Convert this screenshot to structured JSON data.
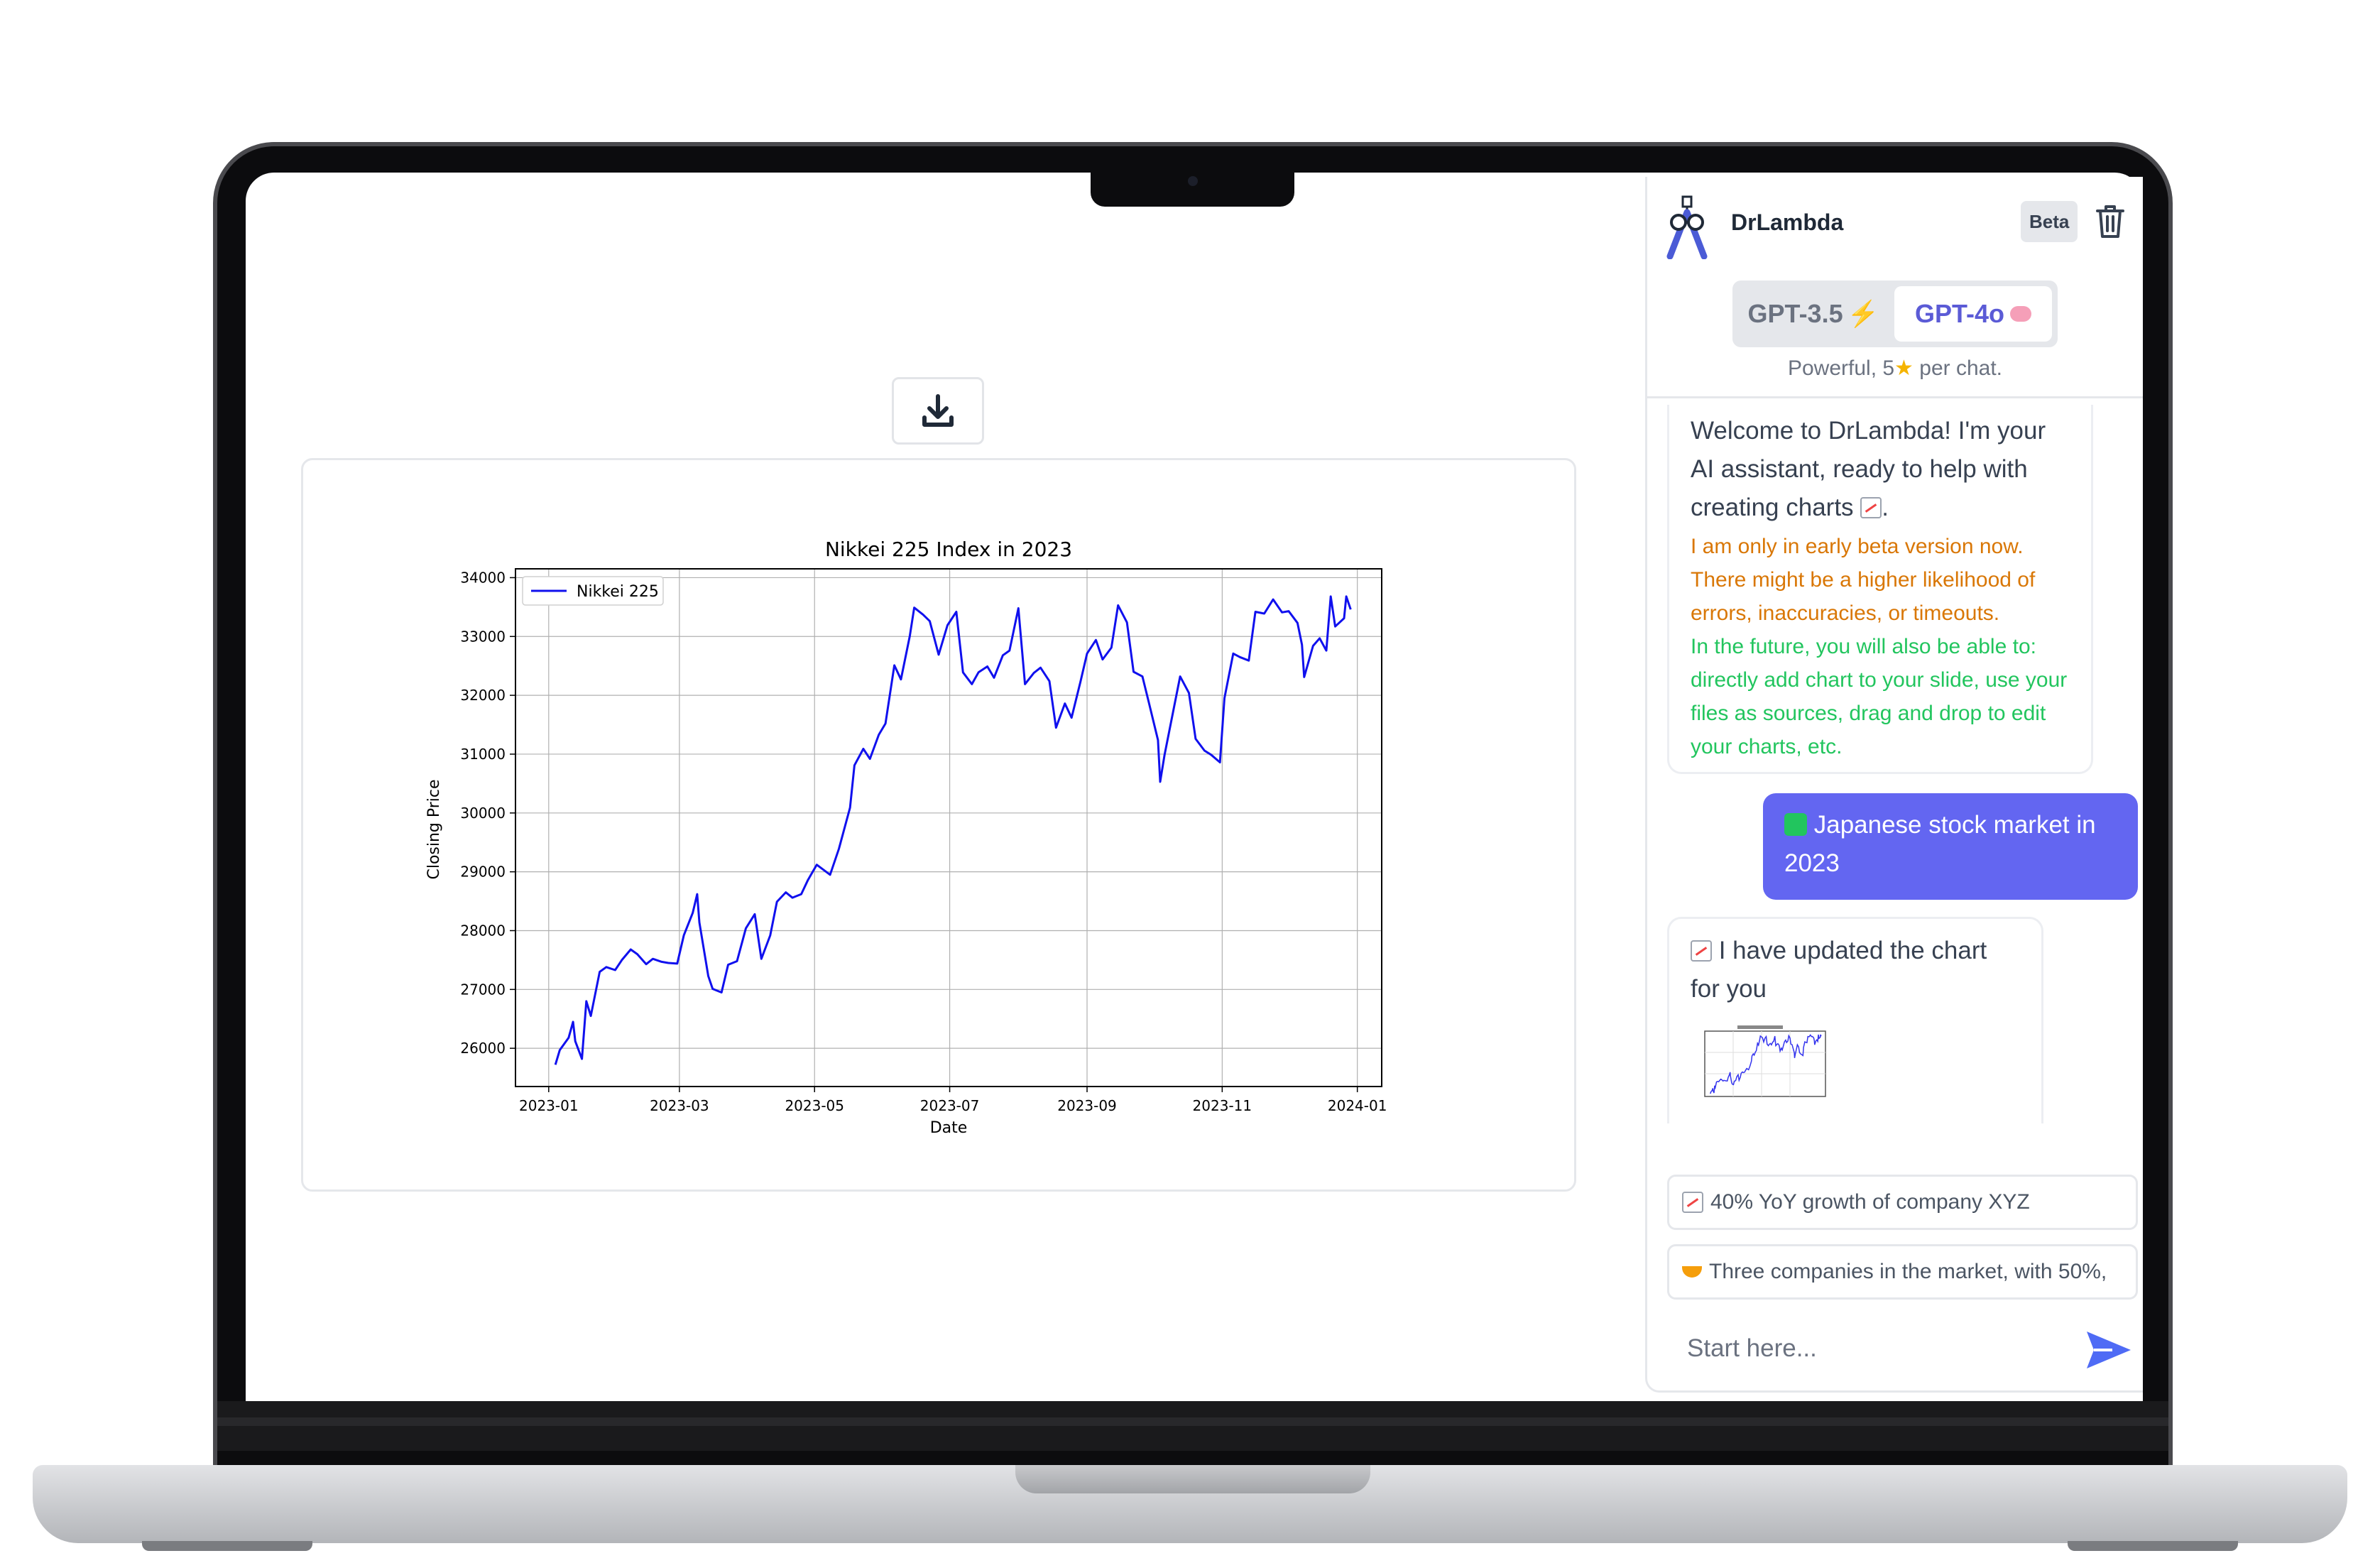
{
  "app": {
    "name": "DrLambda",
    "badge": "Beta"
  },
  "models": {
    "option_a": "GPT-3.5",
    "option_b": "GPT-4o",
    "selected": "GPT-4o",
    "subtitle_prefix": "Powerful, 5",
    "subtitle_suffix": " per chat."
  },
  "messages": {
    "welcome_main": "Welcome to DrLambda! I'm your AI assistant, ready to help with creating charts",
    "welcome_warning": "I am only in early beta version now. There might be a higher likelihood of errors, inaccuracies, or timeouts.",
    "welcome_future": "In the future, you will also be able to: directly add chart to your slide, use your files as sources, drag and drop to edit your charts, etc.",
    "user_message": "Japanese stock market in 2023",
    "bot_reply": "I have updated the chart for you"
  },
  "suggestions": [
    "40% YoY growth of company XYZ",
    "Three companies in the market, with 50%,"
  ],
  "input": {
    "placeholder": "Start here..."
  },
  "colors": {
    "accent": "#6366f1",
    "warning": "#d97706",
    "success": "#22c55e",
    "series": "#1010ee"
  },
  "icons": [
    "download-icon",
    "drlambda-logo",
    "trash-icon",
    "send-icon"
  ],
  "chart_data": {
    "type": "line",
    "title": "Nikkei 225 Index in 2023",
    "xlabel": "Date",
    "ylabel": "Closing Price",
    "x_ticks": [
      "2023-01",
      "2023-03",
      "2023-05",
      "2023-07",
      "2023-09",
      "2023-11",
      "2024-01"
    ],
    "y_ticks": [
      26000,
      27000,
      28000,
      29000,
      30000,
      31000,
      32000,
      33000,
      34000
    ],
    "xlim": [
      "2022-12-17",
      "2024-01-12"
    ],
    "ylim": [
      25350,
      34150
    ],
    "grid": true,
    "legend_position": "top-left",
    "series": [
      {
        "name": "Nikkei 225",
        "points": [
          [
            "2023-01-04",
            25720
          ],
          [
            "2023-01-06",
            25970
          ],
          [
            "2023-01-10",
            26180
          ],
          [
            "2023-01-12",
            26450
          ],
          [
            "2023-01-13",
            26120
          ],
          [
            "2023-01-16",
            25820
          ],
          [
            "2023-01-18",
            26800
          ],
          [
            "2023-01-20",
            26550
          ],
          [
            "2023-01-24",
            27300
          ],
          [
            "2023-01-27",
            27380
          ],
          [
            "2023-01-31",
            27330
          ],
          [
            "2023-02-03",
            27500
          ],
          [
            "2023-02-07",
            27680
          ],
          [
            "2023-02-10",
            27600
          ],
          [
            "2023-02-14",
            27430
          ],
          [
            "2023-02-17",
            27520
          ],
          [
            "2023-02-21",
            27470
          ],
          [
            "2023-02-24",
            27450
          ],
          [
            "2023-02-28",
            27440
          ],
          [
            "2023-03-03",
            27920
          ],
          [
            "2023-03-07",
            28300
          ],
          [
            "2023-03-09",
            28620
          ],
          [
            "2023-03-10",
            28140
          ],
          [
            "2023-03-14",
            27230
          ],
          [
            "2023-03-16",
            27010
          ],
          [
            "2023-03-20",
            26950
          ],
          [
            "2023-03-23",
            27420
          ],
          [
            "2023-03-27",
            27480
          ],
          [
            "2023-03-31",
            28040
          ],
          [
            "2023-04-04",
            28280
          ],
          [
            "2023-04-07",
            27520
          ],
          [
            "2023-04-11",
            27920
          ],
          [
            "2023-04-14",
            28490
          ],
          [
            "2023-04-18",
            28650
          ],
          [
            "2023-04-21",
            28560
          ],
          [
            "2023-04-25",
            28620
          ],
          [
            "2023-04-28",
            28860
          ],
          [
            "2023-05-02",
            29120
          ],
          [
            "2023-05-08",
            28950
          ],
          [
            "2023-05-12",
            29390
          ],
          [
            "2023-05-17",
            30090
          ],
          [
            "2023-05-19",
            30810
          ],
          [
            "2023-05-23",
            31090
          ],
          [
            "2023-05-26",
            30920
          ],
          [
            "2023-05-30",
            31330
          ],
          [
            "2023-06-02",
            31520
          ],
          [
            "2023-06-06",
            32510
          ],
          [
            "2023-06-09",
            32270
          ],
          [
            "2023-06-13",
            33010
          ],
          [
            "2023-06-15",
            33490
          ],
          [
            "2023-06-19",
            33370
          ],
          [
            "2023-06-22",
            33260
          ],
          [
            "2023-06-26",
            32690
          ],
          [
            "2023-06-30",
            33190
          ],
          [
            "2023-07-04",
            33420
          ],
          [
            "2023-07-07",
            32390
          ],
          [
            "2023-07-11",
            32190
          ],
          [
            "2023-07-14",
            32390
          ],
          [
            "2023-07-18",
            32490
          ],
          [
            "2023-07-21",
            32300
          ],
          [
            "2023-07-25",
            32680
          ],
          [
            "2023-07-28",
            32760
          ],
          [
            "2023-08-01",
            33480
          ],
          [
            "2023-08-04",
            32190
          ],
          [
            "2023-08-08",
            32380
          ],
          [
            "2023-08-11",
            32470
          ],
          [
            "2023-08-15",
            32240
          ],
          [
            "2023-08-18",
            31450
          ],
          [
            "2023-08-22",
            31860
          ],
          [
            "2023-08-25",
            31620
          ],
          [
            "2023-08-29",
            32230
          ],
          [
            "2023-09-01",
            32710
          ],
          [
            "2023-09-05",
            32940
          ],
          [
            "2023-09-08",
            32610
          ],
          [
            "2023-09-12",
            32810
          ],
          [
            "2023-09-15",
            33530
          ],
          [
            "2023-09-19",
            33240
          ],
          [
            "2023-09-22",
            32400
          ],
          [
            "2023-09-26",
            32320
          ],
          [
            "2023-09-29",
            31860
          ],
          [
            "2023-10-03",
            31240
          ],
          [
            "2023-10-04",
            30530
          ],
          [
            "2023-10-06",
            30990
          ],
          [
            "2023-10-10",
            31750
          ],
          [
            "2023-10-13",
            32320
          ],
          [
            "2023-10-17",
            32040
          ],
          [
            "2023-10-20",
            31260
          ],
          [
            "2023-10-24",
            31060
          ],
          [
            "2023-10-27",
            30990
          ],
          [
            "2023-10-31",
            30860
          ],
          [
            "2023-11-02",
            31950
          ],
          [
            "2023-11-06",
            32710
          ],
          [
            "2023-11-09",
            32650
          ],
          [
            "2023-11-13",
            32590
          ],
          [
            "2023-11-16",
            33420
          ],
          [
            "2023-11-20",
            33390
          ],
          [
            "2023-11-24",
            33630
          ],
          [
            "2023-11-28",
            33410
          ],
          [
            "2023-12-01",
            33430
          ],
          [
            "2023-12-05",
            33230
          ],
          [
            "2023-12-07",
            32860
          ],
          [
            "2023-12-08",
            32310
          ],
          [
            "2023-12-12",
            32840
          ],
          [
            "2023-12-15",
            32970
          ],
          [
            "2023-12-18",
            32760
          ],
          [
            "2023-12-20",
            33680
          ],
          [
            "2023-12-22",
            33170
          ],
          [
            "2023-12-26",
            33310
          ],
          [
            "2023-12-27",
            33680
          ],
          [
            "2023-12-29",
            33460
          ]
        ]
      }
    ]
  }
}
